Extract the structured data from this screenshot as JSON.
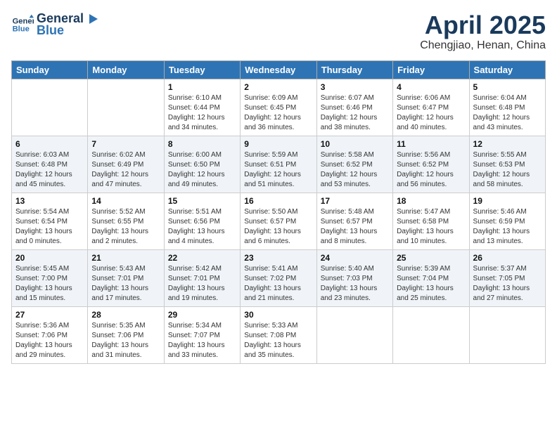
{
  "header": {
    "logo_line1": "General",
    "logo_line2": "Blue",
    "month": "April 2025",
    "location": "Chengjiao, Henan, China"
  },
  "weekdays": [
    "Sunday",
    "Monday",
    "Tuesday",
    "Wednesday",
    "Thursday",
    "Friday",
    "Saturday"
  ],
  "weeks": [
    [
      {
        "day": "",
        "info": ""
      },
      {
        "day": "",
        "info": ""
      },
      {
        "day": "1",
        "info": "Sunrise: 6:10 AM\nSunset: 6:44 PM\nDaylight: 12 hours\nand 34 minutes."
      },
      {
        "day": "2",
        "info": "Sunrise: 6:09 AM\nSunset: 6:45 PM\nDaylight: 12 hours\nand 36 minutes."
      },
      {
        "day": "3",
        "info": "Sunrise: 6:07 AM\nSunset: 6:46 PM\nDaylight: 12 hours\nand 38 minutes."
      },
      {
        "day": "4",
        "info": "Sunrise: 6:06 AM\nSunset: 6:47 PM\nDaylight: 12 hours\nand 40 minutes."
      },
      {
        "day": "5",
        "info": "Sunrise: 6:04 AM\nSunset: 6:48 PM\nDaylight: 12 hours\nand 43 minutes."
      }
    ],
    [
      {
        "day": "6",
        "info": "Sunrise: 6:03 AM\nSunset: 6:48 PM\nDaylight: 12 hours\nand 45 minutes."
      },
      {
        "day": "7",
        "info": "Sunrise: 6:02 AM\nSunset: 6:49 PM\nDaylight: 12 hours\nand 47 minutes."
      },
      {
        "day": "8",
        "info": "Sunrise: 6:00 AM\nSunset: 6:50 PM\nDaylight: 12 hours\nand 49 minutes."
      },
      {
        "day": "9",
        "info": "Sunrise: 5:59 AM\nSunset: 6:51 PM\nDaylight: 12 hours\nand 51 minutes."
      },
      {
        "day": "10",
        "info": "Sunrise: 5:58 AM\nSunset: 6:52 PM\nDaylight: 12 hours\nand 53 minutes."
      },
      {
        "day": "11",
        "info": "Sunrise: 5:56 AM\nSunset: 6:52 PM\nDaylight: 12 hours\nand 56 minutes."
      },
      {
        "day": "12",
        "info": "Sunrise: 5:55 AM\nSunset: 6:53 PM\nDaylight: 12 hours\nand 58 minutes."
      }
    ],
    [
      {
        "day": "13",
        "info": "Sunrise: 5:54 AM\nSunset: 6:54 PM\nDaylight: 13 hours\nand 0 minutes."
      },
      {
        "day": "14",
        "info": "Sunrise: 5:52 AM\nSunset: 6:55 PM\nDaylight: 13 hours\nand 2 minutes."
      },
      {
        "day": "15",
        "info": "Sunrise: 5:51 AM\nSunset: 6:56 PM\nDaylight: 13 hours\nand 4 minutes."
      },
      {
        "day": "16",
        "info": "Sunrise: 5:50 AM\nSunset: 6:57 PM\nDaylight: 13 hours\nand 6 minutes."
      },
      {
        "day": "17",
        "info": "Sunrise: 5:48 AM\nSunset: 6:57 PM\nDaylight: 13 hours\nand 8 minutes."
      },
      {
        "day": "18",
        "info": "Sunrise: 5:47 AM\nSunset: 6:58 PM\nDaylight: 13 hours\nand 10 minutes."
      },
      {
        "day": "19",
        "info": "Sunrise: 5:46 AM\nSunset: 6:59 PM\nDaylight: 13 hours\nand 13 minutes."
      }
    ],
    [
      {
        "day": "20",
        "info": "Sunrise: 5:45 AM\nSunset: 7:00 PM\nDaylight: 13 hours\nand 15 minutes."
      },
      {
        "day": "21",
        "info": "Sunrise: 5:43 AM\nSunset: 7:01 PM\nDaylight: 13 hours\nand 17 minutes."
      },
      {
        "day": "22",
        "info": "Sunrise: 5:42 AM\nSunset: 7:01 PM\nDaylight: 13 hours\nand 19 minutes."
      },
      {
        "day": "23",
        "info": "Sunrise: 5:41 AM\nSunset: 7:02 PM\nDaylight: 13 hours\nand 21 minutes."
      },
      {
        "day": "24",
        "info": "Sunrise: 5:40 AM\nSunset: 7:03 PM\nDaylight: 13 hours\nand 23 minutes."
      },
      {
        "day": "25",
        "info": "Sunrise: 5:39 AM\nSunset: 7:04 PM\nDaylight: 13 hours\nand 25 minutes."
      },
      {
        "day": "26",
        "info": "Sunrise: 5:37 AM\nSunset: 7:05 PM\nDaylight: 13 hours\nand 27 minutes."
      }
    ],
    [
      {
        "day": "27",
        "info": "Sunrise: 5:36 AM\nSunset: 7:06 PM\nDaylight: 13 hours\nand 29 minutes."
      },
      {
        "day": "28",
        "info": "Sunrise: 5:35 AM\nSunset: 7:06 PM\nDaylight: 13 hours\nand 31 minutes."
      },
      {
        "day": "29",
        "info": "Sunrise: 5:34 AM\nSunset: 7:07 PM\nDaylight: 13 hours\nand 33 minutes."
      },
      {
        "day": "30",
        "info": "Sunrise: 5:33 AM\nSunset: 7:08 PM\nDaylight: 13 hours\nand 35 minutes."
      },
      {
        "day": "",
        "info": ""
      },
      {
        "day": "",
        "info": ""
      },
      {
        "day": "",
        "info": ""
      }
    ]
  ]
}
